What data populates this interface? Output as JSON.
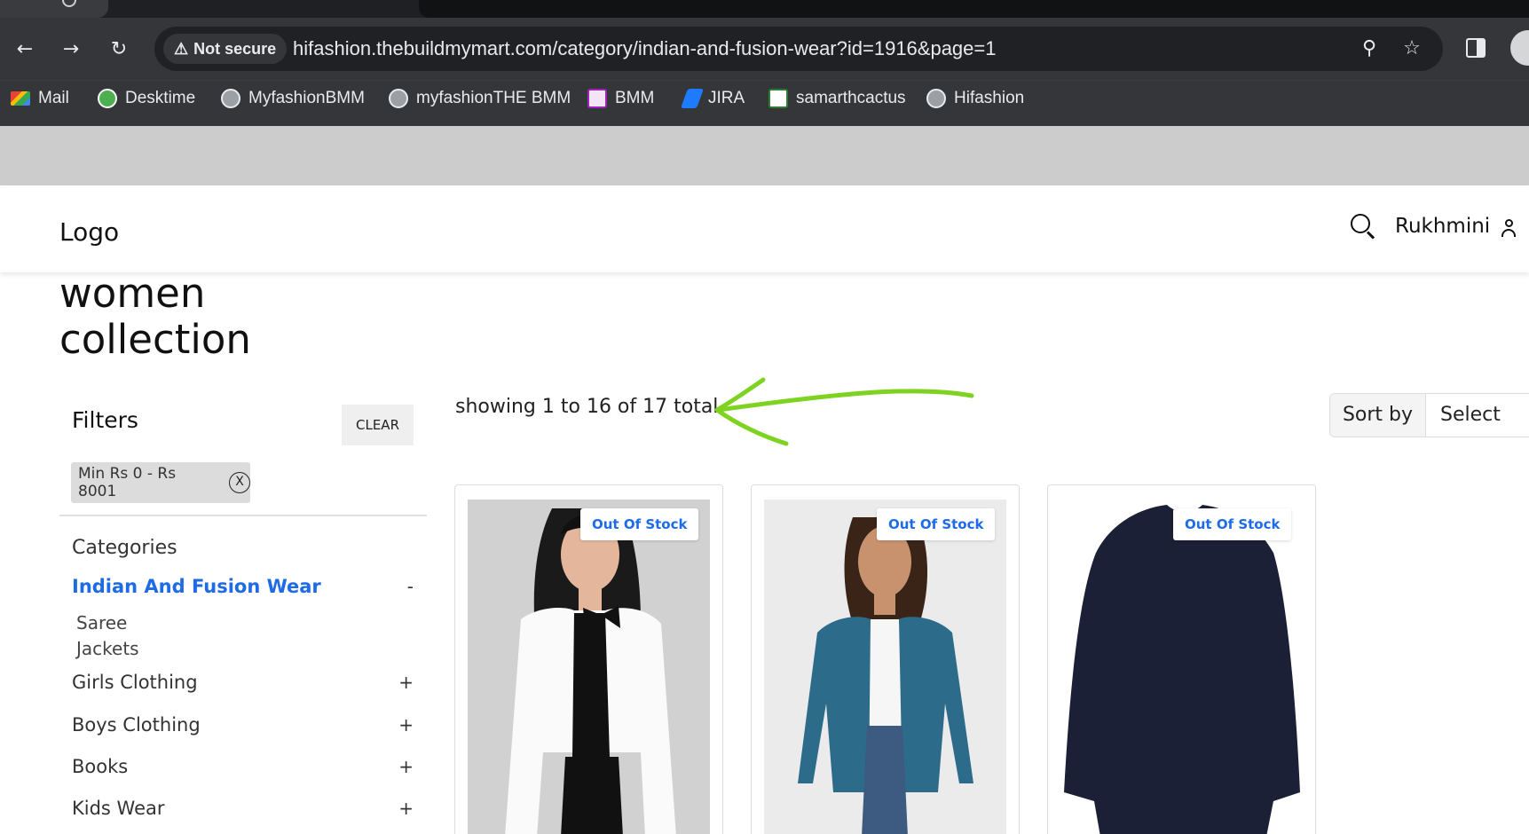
{
  "browser": {
    "security_label": "Not secure",
    "url": "hifashion.thebuildmymart.com/category/indian-and-fusion-wear?id=1916&page=1",
    "bookmarks": [
      {
        "label": "Mail",
        "icon": "gmail-icon"
      },
      {
        "label": "Desktime",
        "icon": "desktime-icon"
      },
      {
        "label": "MyfashionBMM",
        "icon": "globe-icon"
      },
      {
        "label": "myfashionTHE BMM",
        "icon": "globe-icon"
      },
      {
        "label": "BMM",
        "icon": "bmm-icon"
      },
      {
        "label": "JIRA",
        "icon": "jira-icon"
      },
      {
        "label": "samarthcactus",
        "icon": "cactus-icon"
      },
      {
        "label": "Hifashion",
        "icon": "globe-icon"
      }
    ]
  },
  "header": {
    "logo": "Logo",
    "username": "Rukhmini"
  },
  "page": {
    "title_line1": "women",
    "title_line2": "collection"
  },
  "filters": {
    "title": "Filters",
    "clear_label": "CLEAR",
    "price_chip": "Min Rs 0 - Rs 8001",
    "chip_close": "X",
    "categories_heading": "Categories",
    "categories": [
      {
        "label": "Indian And Fusion Wear",
        "toggle": "-",
        "active": true
      },
      {
        "label": "Girls Clothing",
        "toggle": "+"
      },
      {
        "label": "Boys Clothing",
        "toggle": "+"
      },
      {
        "label": "Books",
        "toggle": "+"
      },
      {
        "label": "Kids Wear",
        "toggle": "+"
      }
    ],
    "subcategories": [
      "Saree",
      "Jackets"
    ]
  },
  "listing": {
    "showing_text": "showing 1 to 16 of 17 total",
    "sort_label": "Sort by",
    "sort_value": "Select",
    "products": [
      {
        "badge": "Out Of Stock",
        "image": "white-jacket-model"
      },
      {
        "badge": "Out Of Stock",
        "image": "teal-shrug-model"
      },
      {
        "badge": "Out Of Stock",
        "image": "navy-sweater"
      }
    ]
  },
  "colors": {
    "accent": "#1e6be6",
    "annotation_arrow": "#7ed321"
  }
}
